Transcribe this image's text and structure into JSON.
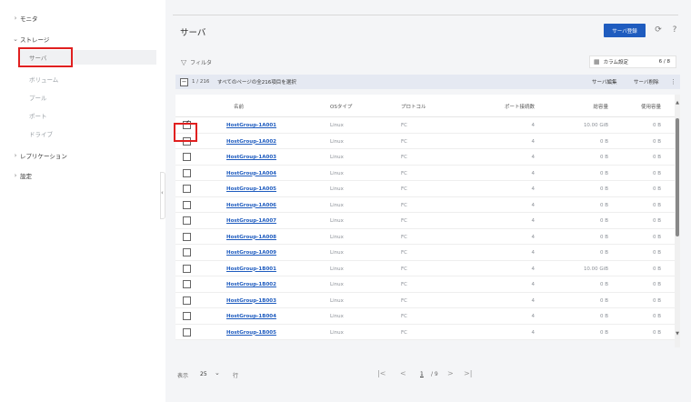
{
  "sidebar": {
    "items": [
      {
        "chev": "›",
        "label": "モニタ"
      },
      {
        "chev": "⌄",
        "label": "ストレージ"
      },
      {
        "chev": "›",
        "label": "レプリケーション"
      },
      {
        "chev": "›",
        "label": "設定"
      }
    ],
    "storage_children": [
      "サーバ",
      "ボリューム",
      "プール",
      "ポート",
      "ドライブ"
    ]
  },
  "header": {
    "title": "サーバ",
    "register_label": "サーバ登録",
    "refresh_icon": "refresh-icon",
    "help_icon": "help-icon"
  },
  "toolbar": {
    "filter_label": "フィルタ",
    "column_settings_label": "カラム設定",
    "column_count": "6 / 8"
  },
  "selection_bar": {
    "count": "1 / 216",
    "select_all_label": "すべてのページの全216項目を選択",
    "edit_label": "サーバ編集",
    "delete_label": "サーバ削除",
    "more_label": "⋮"
  },
  "table": {
    "columns": [
      "名前",
      "OSタイプ",
      "プロトコル",
      "ポート接続数",
      "総容量",
      "使用容量"
    ],
    "rows": [
      {
        "checked": true,
        "name": "HostGroup-1A001",
        "os": "Linux",
        "protocol": "FC",
        "ports": "4",
        "total": "10.00 GiB",
        "used": "0 B"
      },
      {
        "checked": false,
        "name": "HostGroup-1A002",
        "os": "Linux",
        "protocol": "FC",
        "ports": "4",
        "total": "0 B",
        "used": "0 B"
      },
      {
        "checked": false,
        "name": "HostGroup-1A003",
        "os": "Linux",
        "protocol": "FC",
        "ports": "4",
        "total": "0 B",
        "used": "0 B"
      },
      {
        "checked": false,
        "name": "HostGroup-1A004",
        "os": "Linux",
        "protocol": "FC",
        "ports": "4",
        "total": "0 B",
        "used": "0 B"
      },
      {
        "checked": false,
        "name": "HostGroup-1A005",
        "os": "Linux",
        "protocol": "FC",
        "ports": "4",
        "total": "0 B",
        "used": "0 B"
      },
      {
        "checked": false,
        "name": "HostGroup-1A006",
        "os": "Linux",
        "protocol": "FC",
        "ports": "4",
        "total": "0 B",
        "used": "0 B"
      },
      {
        "checked": false,
        "name": "HostGroup-1A007",
        "os": "Linux",
        "protocol": "FC",
        "ports": "4",
        "total": "0 B",
        "used": "0 B"
      },
      {
        "checked": false,
        "name": "HostGroup-1A008",
        "os": "Linux",
        "protocol": "FC",
        "ports": "4",
        "total": "0 B",
        "used": "0 B"
      },
      {
        "checked": false,
        "name": "HostGroup-1A009",
        "os": "Linux",
        "protocol": "FC",
        "ports": "4",
        "total": "0 B",
        "used": "0 B"
      },
      {
        "checked": false,
        "name": "HostGroup-1B001",
        "os": "Linux",
        "protocol": "FC",
        "ports": "4",
        "total": "10.00 GiB",
        "used": "0 B"
      },
      {
        "checked": false,
        "name": "HostGroup-1B002",
        "os": "Linux",
        "protocol": "FC",
        "ports": "4",
        "total": "0 B",
        "used": "0 B"
      },
      {
        "checked": false,
        "name": "HostGroup-1B003",
        "os": "Linux",
        "protocol": "FC",
        "ports": "4",
        "total": "0 B",
        "used": "0 B"
      },
      {
        "checked": false,
        "name": "HostGroup-1B004",
        "os": "Linux",
        "protocol": "FC",
        "ports": "4",
        "total": "0 B",
        "used": "0 B"
      },
      {
        "checked": false,
        "name": "HostGroup-1B005",
        "os": "Linux",
        "protocol": "FC",
        "ports": "4",
        "total": "0 B",
        "used": "0 B"
      }
    ]
  },
  "footer": {
    "show_label": "表示",
    "page_size": "25",
    "rows_label": "行",
    "current_page": "1",
    "total_pages": "/ 9"
  },
  "colors": {
    "primary": "#1f5cbf",
    "highlight_box": "#e02020"
  }
}
